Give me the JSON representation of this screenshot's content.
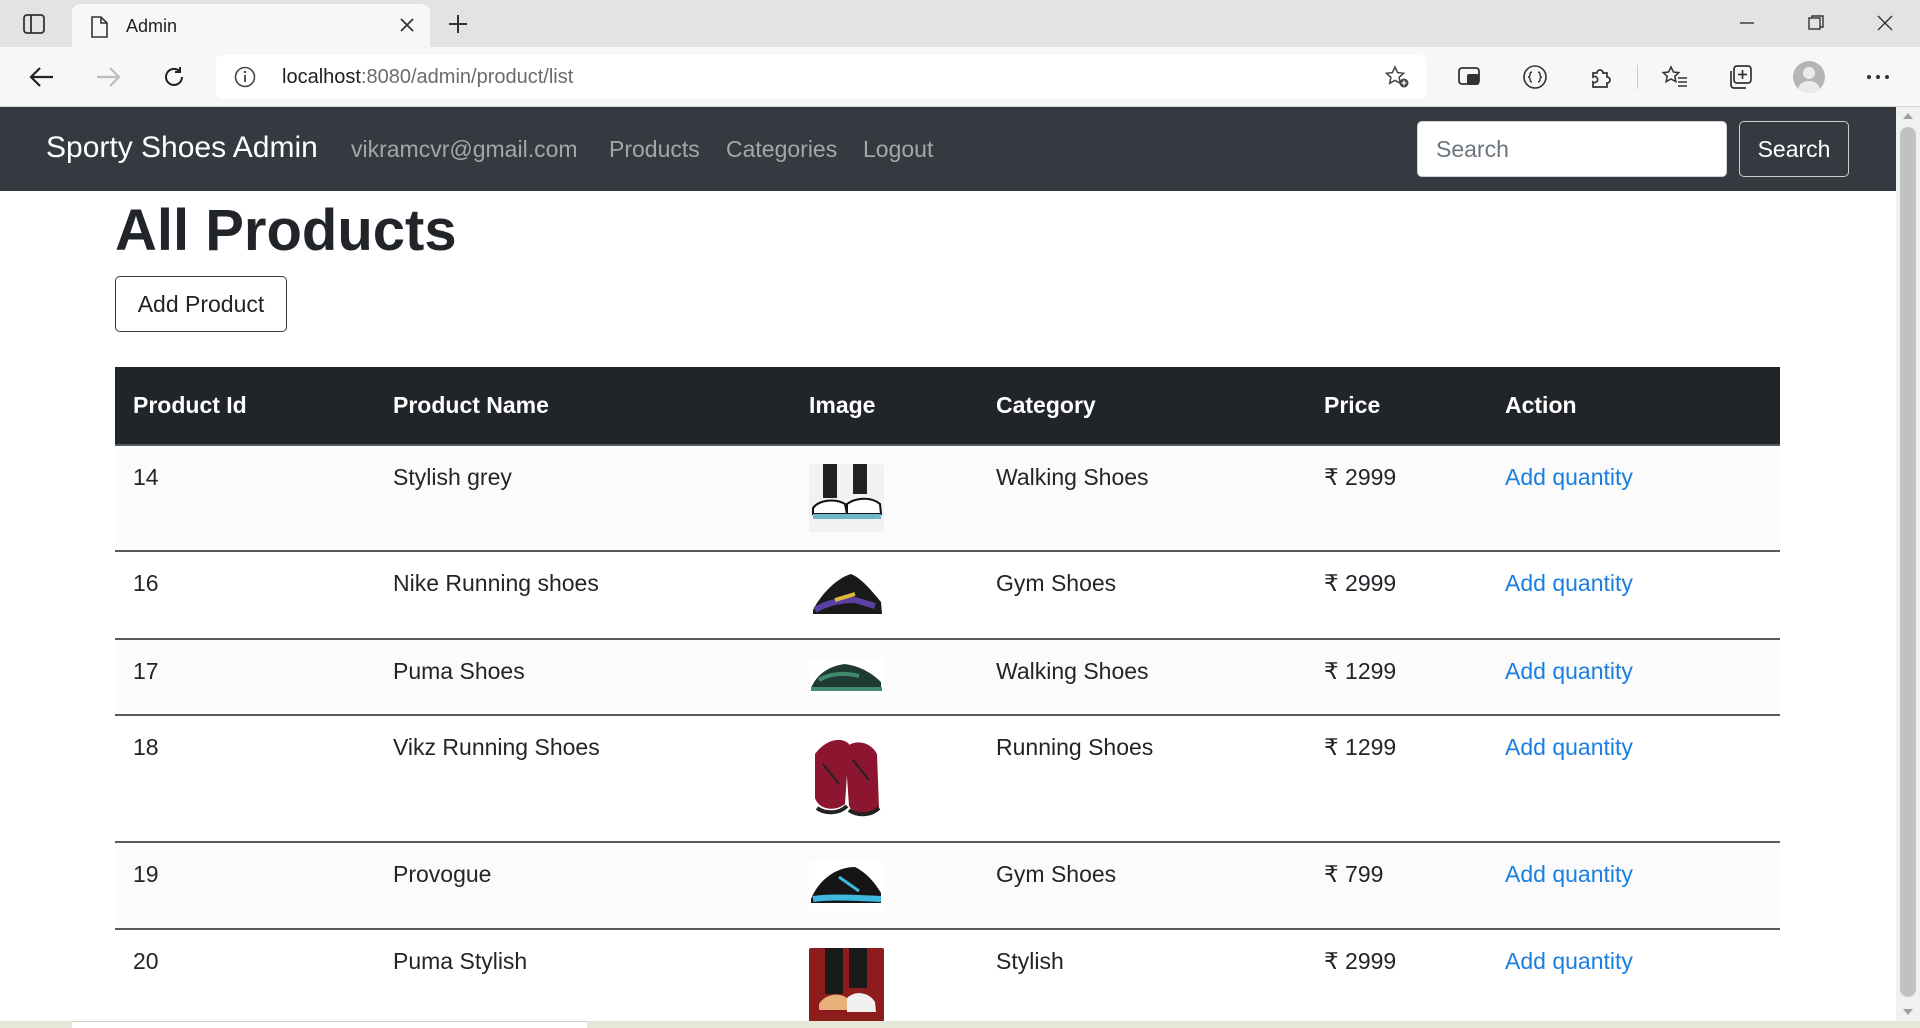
{
  "browser": {
    "tab_title": "Admin",
    "url_host": "localhost",
    "url_path": ":8080/admin/product/list",
    "icons": [
      "tab-actions-icon",
      "page-icon",
      "close-tab-icon",
      "new-tab-icon",
      "minimize-icon",
      "restore-icon",
      "close-window-icon",
      "back-icon",
      "forward-icon",
      "refresh-icon",
      "site-info-icon",
      "add-favorite-icon",
      "browser-essentials-icon",
      "extension-braces-icon",
      "extensions-icon",
      "favorites-icon",
      "collections-icon",
      "profile-icon",
      "more-menu-icon"
    ]
  },
  "navbar": {
    "brand": "Sporty Shoes Admin",
    "links": [
      "vikramcvr@gmail.com",
      "Products",
      "Categories",
      "Logout"
    ],
    "search_placeholder": "Search",
    "search_button": "Search"
  },
  "page": {
    "title": "All Products",
    "add_button": "Add Product"
  },
  "table": {
    "headers": [
      "Product Id",
      "Product Name",
      "Image",
      "Category",
      "Price",
      "Action"
    ],
    "rows": [
      {
        "id": "14",
        "name": "Stylish grey",
        "category": "Walking Shoes",
        "price": "₹ 2999",
        "action": "Add quantity",
        "image": "sneaker-grey-on-feet",
        "colors": [
          "#f2f2f2",
          "#111111",
          "#6fb6c9"
        ]
      },
      {
        "id": "16",
        "name": "Nike Running shoes",
        "category": "Gym Shoes",
        "price": "₹ 2999",
        "action": "Add quantity",
        "image": "sneaker-black-purple-gold",
        "colors": [
          "#ffffff",
          "#1a1a1a",
          "#5b3fa3"
        ]
      },
      {
        "id": "17",
        "name": "Puma Shoes",
        "category": "Walking Shoes",
        "price": "₹ 1299",
        "action": "Add quantity",
        "image": "sneaker-dark-green",
        "colors": [
          "#ffffff",
          "#1f3a33",
          "#3f8a6a"
        ]
      },
      {
        "id": "18",
        "name": "Vikz Running Shoes",
        "category": "Running Shoes",
        "price": "₹ 1299",
        "action": "Add quantity",
        "image": "sneaker-maroon-pair",
        "colors": [
          "#ffffff",
          "#8c1630",
          "#222222"
        ]
      },
      {
        "id": "19",
        "name": "Provogue",
        "category": "Gym Shoes",
        "price": "₹ 799",
        "action": "Add quantity",
        "image": "sneaker-black-cyan",
        "colors": [
          "#ffffff",
          "#151515",
          "#3fb8e0"
        ]
      },
      {
        "id": "20",
        "name": "Puma Stylish",
        "category": "Stylish",
        "price": "₹ 2999",
        "action": "Add quantity",
        "image": "sneaker-on-red-background",
        "colors": [
          "#8d1d1d",
          "#1a1a1a",
          "#e8b07a"
        ]
      }
    ]
  },
  "colors": {
    "navbar_bg": "#343a40",
    "table_head_bg": "#212529",
    "link": "#1a7fe0"
  }
}
